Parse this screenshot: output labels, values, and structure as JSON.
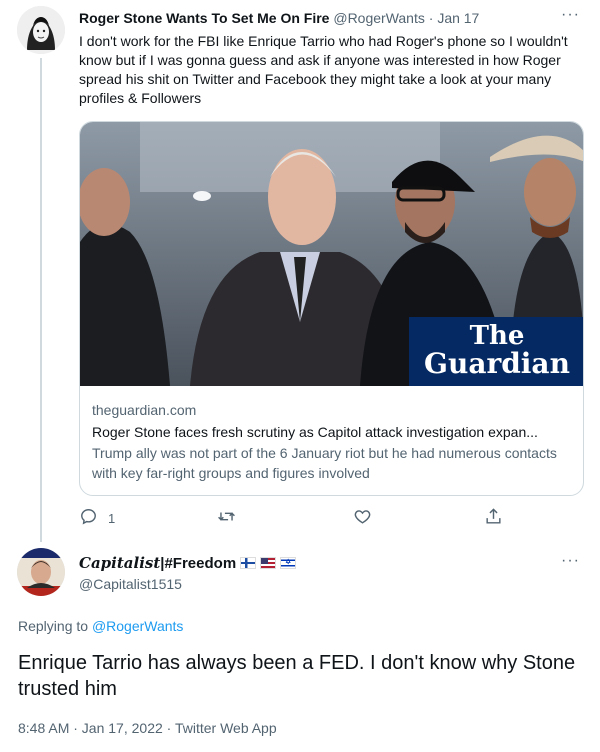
{
  "tweet1": {
    "display_name": "Roger Stone Wants To Set Me On Fire",
    "handle": "@RogerWants",
    "separator": "·",
    "date": "Jan 17",
    "more": "···",
    "text": "I don't work for the FBI like Enrique Tarrio who had Roger's phone so I wouldn't know but if I was gonna guess and ask if anyone was interested in how Roger spread his shit on Twitter and Facebook they might take a look at your many profiles & Followers",
    "card": {
      "logo_line1": "The",
      "logo_line2": "Guardian",
      "domain": "theguardian.com",
      "title": "Roger Stone faces fresh scrutiny as Capitol attack investigation expan...",
      "description": "Trump ally was not part of the 6 January riot but he had numerous contacts with key far-right groups and figures involved"
    },
    "actions": {
      "reply_count": "1"
    }
  },
  "tweet2": {
    "display_name_stylized": "Capitalist",
    "display_name_rest": " |#Freedom",
    "handle": "@Capitalist1515",
    "more": "···",
    "replying_prefix": "Replying to ",
    "replying_to": "@RogerWants",
    "text": "Enrique Tarrio has always been a FED. I don't know why Stone trusted him",
    "meta": "8:48 AM · Jan 17, 2022 · Twitter Web App",
    "avatar_text_top": "PAUL MANAFORT",
    "avatar_text_bottom": "POLITICAL PRISONER"
  },
  "colors": {
    "accent": "#1d9bf0",
    "secondary_text": "#536471",
    "border": "#cfd9de",
    "guardian_blue": "#052962"
  },
  "icons": [
    "reply-icon",
    "retweet-icon",
    "like-icon",
    "share-icon",
    "more-icon"
  ]
}
